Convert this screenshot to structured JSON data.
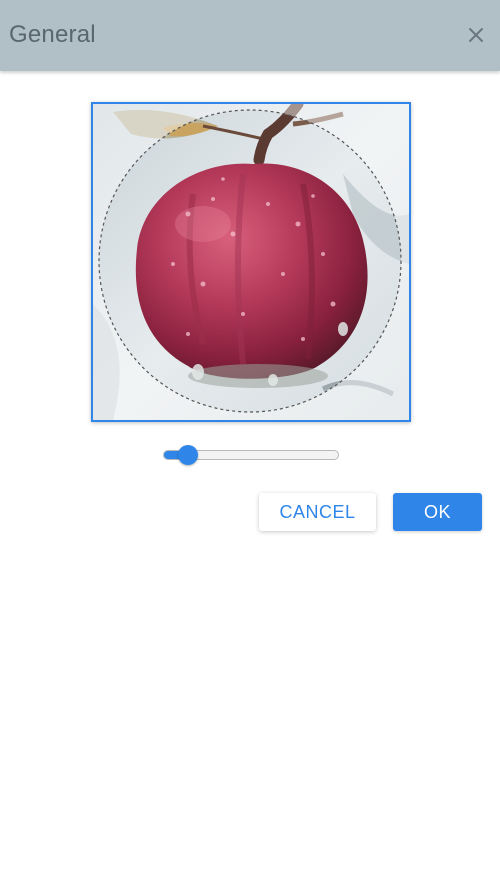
{
  "dialog": {
    "title": "General",
    "close_icon": "close-icon"
  },
  "cropper": {
    "image_subject": "apple-photo",
    "crop_shape": "circle"
  },
  "zoom": {
    "value": 0.1
  },
  "actions": {
    "cancel_label": "CANCEL",
    "ok_label": "OK"
  },
  "colors": {
    "header_bg": "#b1bfc6",
    "accent": "#2f86e8",
    "title_text": "#5a6670"
  }
}
